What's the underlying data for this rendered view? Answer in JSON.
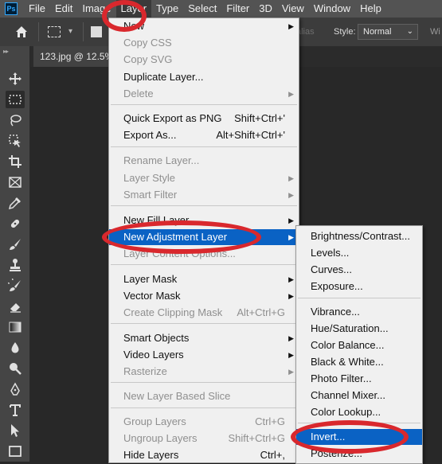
{
  "app": {
    "logo": "Ps"
  },
  "menubar": [
    "File",
    "Edit",
    "Image",
    "Layer",
    "Type",
    "Select",
    "Filter",
    "3D",
    "View",
    "Window",
    "Help"
  ],
  "options_bar": {
    "antialias_label": "alias",
    "style_label": "Style:",
    "style_value": "Normal",
    "width_label": "Wi"
  },
  "document_tab": {
    "title": "123.jpg @ 12.5%"
  },
  "layer_menu": [
    {
      "label": "New",
      "submenu": true
    },
    {
      "label": "Copy CSS",
      "disabled": true
    },
    {
      "label": "Copy SVG",
      "disabled": true
    },
    {
      "label": "Duplicate Layer..."
    },
    {
      "label": "Delete",
      "disabled": true,
      "submenu": true
    },
    {
      "label": "Quick Export as PNG",
      "shortcut": "Shift+Ctrl+'"
    },
    {
      "label": "Export As...",
      "shortcut": "Alt+Shift+Ctrl+'"
    },
    {
      "label": "Rename Layer...",
      "disabled": true
    },
    {
      "label": "Layer Style",
      "disabled": true,
      "submenu": true
    },
    {
      "label": "Smart Filter",
      "disabled": true,
      "submenu": true
    },
    {
      "label": "New Fill Layer",
      "submenu": true
    },
    {
      "label": "New Adjustment Layer",
      "submenu": true,
      "highlighted": true
    },
    {
      "label": "Layer Content Options...",
      "disabled": true
    },
    {
      "label": "Layer Mask",
      "submenu": true
    },
    {
      "label": "Vector Mask",
      "submenu": true
    },
    {
      "label": "Create Clipping Mask",
      "shortcut": "Alt+Ctrl+G",
      "disabled": true
    },
    {
      "label": "Smart Objects",
      "submenu": true
    },
    {
      "label": "Video Layers",
      "submenu": true
    },
    {
      "label": "Rasterize",
      "disabled": true,
      "submenu": true
    },
    {
      "label": "New Layer Based Slice",
      "disabled": true
    },
    {
      "label": "Group Layers",
      "shortcut": "Ctrl+G",
      "disabled": true
    },
    {
      "label": "Ungroup Layers",
      "shortcut": "Shift+Ctrl+G",
      "disabled": true
    },
    {
      "label": "Hide Layers",
      "shortcut": "Ctrl+,"
    }
  ],
  "adjustment_menu": [
    {
      "label": "Brightness/Contrast..."
    },
    {
      "label": "Levels..."
    },
    {
      "label": "Curves..."
    },
    {
      "label": "Exposure..."
    },
    {
      "label": "Vibrance..."
    },
    {
      "label": "Hue/Saturation..."
    },
    {
      "label": "Color Balance..."
    },
    {
      "label": "Black & White..."
    },
    {
      "label": "Photo Filter..."
    },
    {
      "label": "Channel Mixer..."
    },
    {
      "label": "Color Lookup..."
    },
    {
      "label": "Invert...",
      "highlighted": true
    },
    {
      "label": "Posterize..."
    }
  ],
  "annotation_color": "#d9282d",
  "highlight_color": "#0a62c4"
}
